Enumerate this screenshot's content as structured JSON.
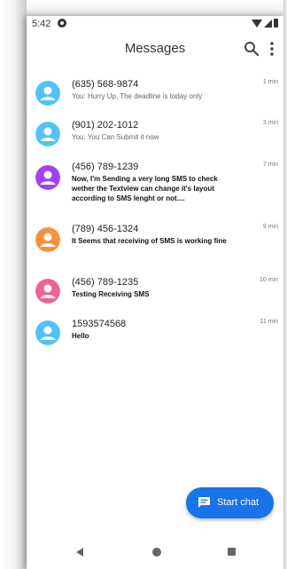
{
  "status_bar": {
    "time": "5:42"
  },
  "app_bar": {
    "title": "Messages",
    "search_icon": "search-icon",
    "more_icon": "more-vert-icon"
  },
  "conversations": [
    {
      "name": "(635) 568-9874",
      "preview": "You: Hurry Up, The deadline is today only",
      "time": "1 min",
      "avatar_color": "#4fc3f7",
      "unread": false
    },
    {
      "name": "(901) 202-1012",
      "preview": "You: You Can Submit it now",
      "time": "3 min",
      "avatar_color": "#4fc3f7",
      "unread": false
    },
    {
      "name": "(456) 789-1239",
      "preview": "Now, I'm Sending a very long SMS to check wether the Textview can change it's layout according to SMS lenght or not....",
      "time": "7 min",
      "avatar_color": "#a142f4",
      "unread": true
    },
    {
      "name": "(789) 456-1324",
      "preview": "It Seems that receiving of SMS is working fine",
      "time": "9 min",
      "avatar_color": "#fa903e",
      "unread": true
    },
    {
      "name": "(456) 789-1235",
      "preview": "Testing Receiving SMS",
      "time": "10 min",
      "avatar_color": "#f06292",
      "unread": true
    },
    {
      "name": "1593574568",
      "preview": "Hello",
      "time": "11 min",
      "avatar_color": "#4fc3f7",
      "unread": true
    }
  ],
  "fab": {
    "label": "Start chat",
    "color": "#1a73e8",
    "icon": "chat-icon"
  },
  "nav_bar": {
    "back_icon": "back-icon",
    "home_icon": "home-icon",
    "recents_icon": "recents-icon"
  }
}
